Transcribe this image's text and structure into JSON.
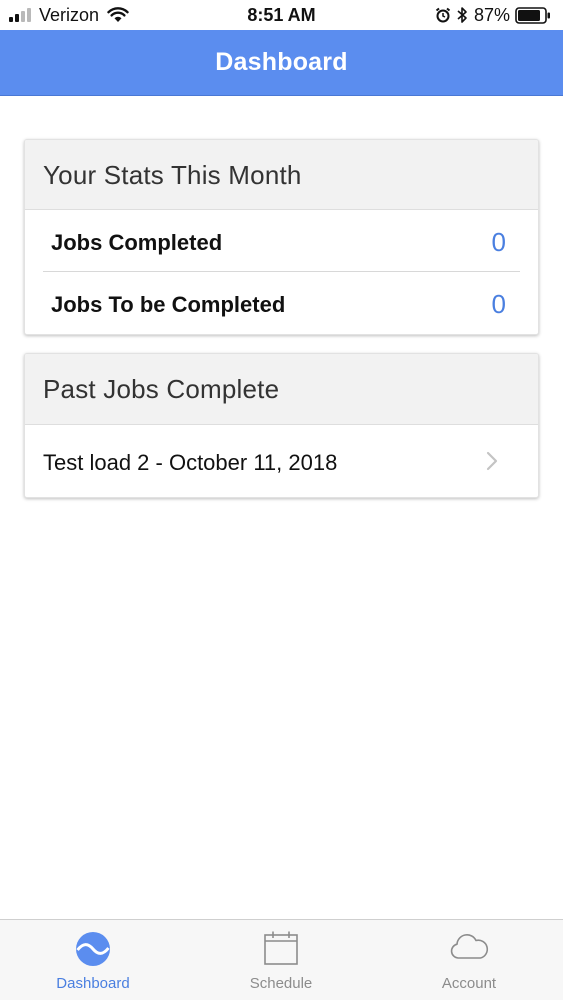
{
  "status_bar": {
    "carrier": "Verizon",
    "time": "8:51 AM",
    "battery_percent": "87%",
    "signal_bars": 2,
    "icons": [
      "signal-icon",
      "wifi-icon",
      "alarm-icon",
      "bluetooth-icon",
      "battery-icon"
    ]
  },
  "header": {
    "title": "Dashboard",
    "color": "#5b8def"
  },
  "stats_card": {
    "title": "Your Stats This Month",
    "rows": [
      {
        "label": "Jobs Completed",
        "value": "0"
      },
      {
        "label": "Jobs To be Completed",
        "value": "0"
      }
    ]
  },
  "past_jobs_card": {
    "title": "Past Jobs Complete",
    "items": [
      {
        "label": "Test load 2 - October 11, 2018",
        "icon": "chevron-right-icon"
      }
    ]
  },
  "tab_bar": {
    "tabs": [
      {
        "label": "Dashboard",
        "icon": "dashboard-icon",
        "active": true
      },
      {
        "label": "Schedule",
        "icon": "calendar-icon",
        "active": false
      },
      {
        "label": "Account",
        "icon": "cloud-icon",
        "active": false
      }
    ]
  },
  "colors": {
    "accent": "#4a7fe0",
    "inactive": "#8c8c8c"
  }
}
